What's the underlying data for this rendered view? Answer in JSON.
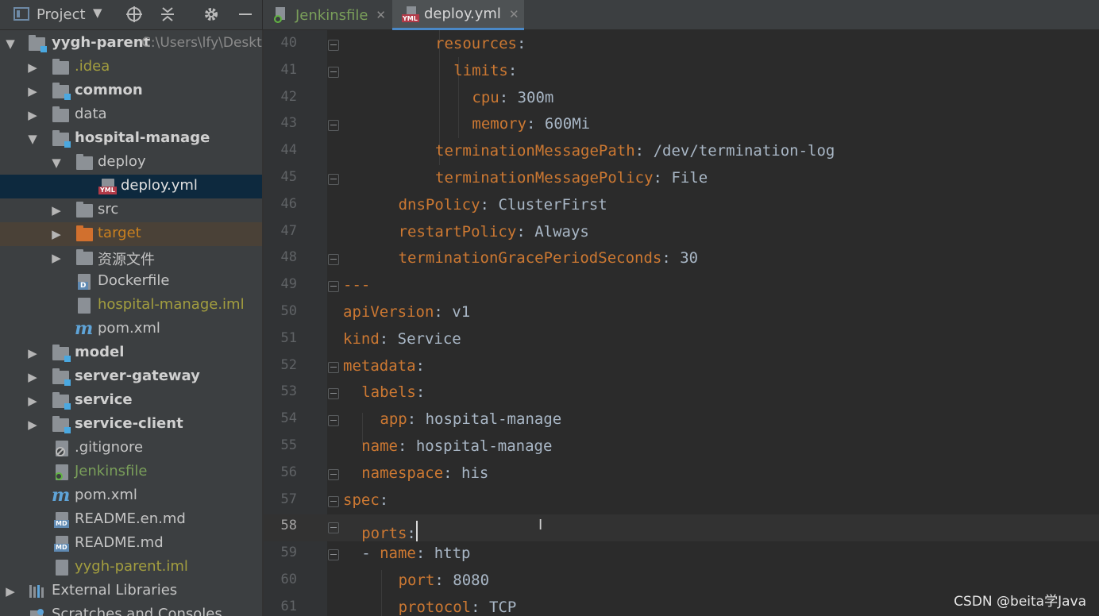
{
  "toolbar": {
    "project_label": "Project",
    "icons": [
      "project-view-icon",
      "dropdown-caret-icon",
      "crosshair-icon",
      "collapse-all-icon",
      "gear-icon",
      "minimize-icon"
    ]
  },
  "tabs": [
    {
      "label": "Jenkinsfile",
      "icon": "jenkins-file-icon",
      "active": false
    },
    {
      "label": "deploy.yml",
      "icon": "yml-file-icon",
      "active": true
    }
  ],
  "tree": {
    "root": {
      "label": "yygh-parent",
      "path": "C:\\Users\\lfy\\Deskto"
    },
    "items": [
      {
        "label": ".idea"
      },
      {
        "label": "common"
      },
      {
        "label": "data"
      },
      {
        "label": "hospital-manage"
      },
      {
        "label": "deploy"
      },
      {
        "label": "deploy.yml"
      },
      {
        "label": "src"
      },
      {
        "label": "target"
      },
      {
        "label": "资源文件"
      },
      {
        "label": "Dockerfile"
      },
      {
        "label": "hospital-manage.iml"
      },
      {
        "label": "pom.xml"
      },
      {
        "label": "model"
      },
      {
        "label": "server-gateway"
      },
      {
        "label": "service"
      },
      {
        "label": "service-client"
      },
      {
        "label": ".gitignore"
      },
      {
        "label": "Jenkinsfile"
      },
      {
        "label": "pom.xml"
      },
      {
        "label": "README.en.md"
      },
      {
        "label": "README.md"
      },
      {
        "label": "yygh-parent.iml"
      },
      {
        "label": "External Libraries"
      },
      {
        "label": "Scratches and Consoles"
      }
    ]
  },
  "editor": {
    "current_line": "58",
    "lines": [
      {
        "n": "40",
        "key": "resources",
        "sep": ":",
        "val": ""
      },
      {
        "n": "41",
        "key": "limits",
        "sep": ":",
        "val": ""
      },
      {
        "n": "42",
        "key": "cpu",
        "sep": ": ",
        "val": "300m"
      },
      {
        "n": "43",
        "key": "memory",
        "sep": ": ",
        "val": "600Mi"
      },
      {
        "n": "44",
        "key": "terminationMessagePath",
        "sep": ": ",
        "val": "/dev/termination-log"
      },
      {
        "n": "45",
        "key": "terminationMessagePolicy",
        "sep": ": ",
        "val": "File"
      },
      {
        "n": "46",
        "key": "dnsPolicy",
        "sep": ": ",
        "val": "ClusterFirst"
      },
      {
        "n": "47",
        "key": "restartPolicy",
        "sep": ": ",
        "val": "Always"
      },
      {
        "n": "48",
        "key": "terminationGracePeriodSeconds",
        "sep": ": ",
        "val": "30"
      },
      {
        "n": "49",
        "key": "",
        "sep": "",
        "val": "---"
      },
      {
        "n": "50",
        "key": "apiVersion",
        "sep": ": ",
        "val": "v1"
      },
      {
        "n": "51",
        "key": "kind",
        "sep": ": ",
        "val": "Service"
      },
      {
        "n": "52",
        "key": "metadata",
        "sep": ":",
        "val": ""
      },
      {
        "n": "53",
        "key": "labels",
        "sep": ":",
        "val": ""
      },
      {
        "n": "54",
        "key": "app",
        "sep": ": ",
        "val": "hospital-manage"
      },
      {
        "n": "55",
        "key": "name",
        "sep": ": ",
        "val": "hospital-manage"
      },
      {
        "n": "56",
        "key": "namespace",
        "sep": ": ",
        "val": "his"
      },
      {
        "n": "57",
        "key": "spec",
        "sep": ":",
        "val": ""
      },
      {
        "n": "58",
        "key": "ports",
        "sep": ":",
        "val": ""
      },
      {
        "n": "59",
        "key": "name",
        "sep": ": ",
        "val": "http",
        "dash": "- "
      },
      {
        "n": "60",
        "key": "port",
        "sep": ": ",
        "val": "8080"
      },
      {
        "n": "61",
        "key": "protocol",
        "sep": ": ",
        "val": "TCP"
      }
    ]
  },
  "watermark": "CSDN @beita学Java"
}
